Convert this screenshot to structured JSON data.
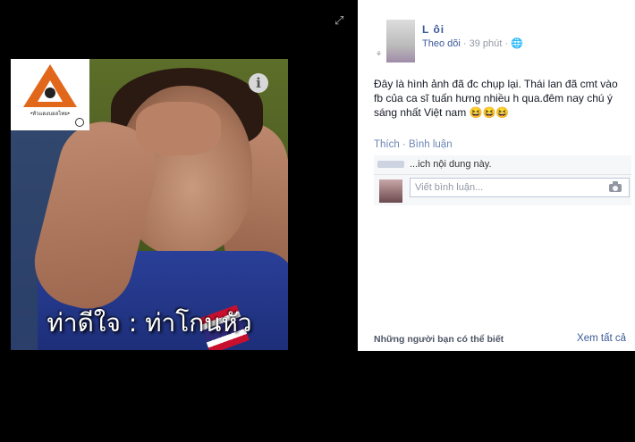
{
  "viewer": {
    "expand_icon": "expand-icon",
    "photo": {
      "info_glyph": "i",
      "caption": "ท่าดีใจ : ท่าโกนหัว",
      "logo_caption": "•หัวแดงบอลไทย•"
    }
  },
  "post": {
    "author_name": "L          ôi",
    "follow_label": "Theo dõi",
    "separator": "·",
    "time": "39 phút",
    "privacy_icon": "globe-icon",
    "text": "Đây là hình ảnh đã đc chụp lại. Thái lan đã cmt vào fb của ca sĩ tuấn hưng nhiều h qua.đêm nay chú ý sáng nhất Việt nam 😆😆😆",
    "like_label": "Thích",
    "action_separator": " · ",
    "comment_label": "Bình luận",
    "liked_text": "        ...ich nội dung này.",
    "comment_placeholder": "Viết bình luận...",
    "camera_icon": "camera-icon"
  },
  "sidebar": {
    "pymk_label": "Những người bạn có thể biết",
    "see_all_label": "Xem tất cả"
  },
  "colors": {
    "link": "#3b5998",
    "meta": "#9197a3",
    "background": "#000000"
  }
}
